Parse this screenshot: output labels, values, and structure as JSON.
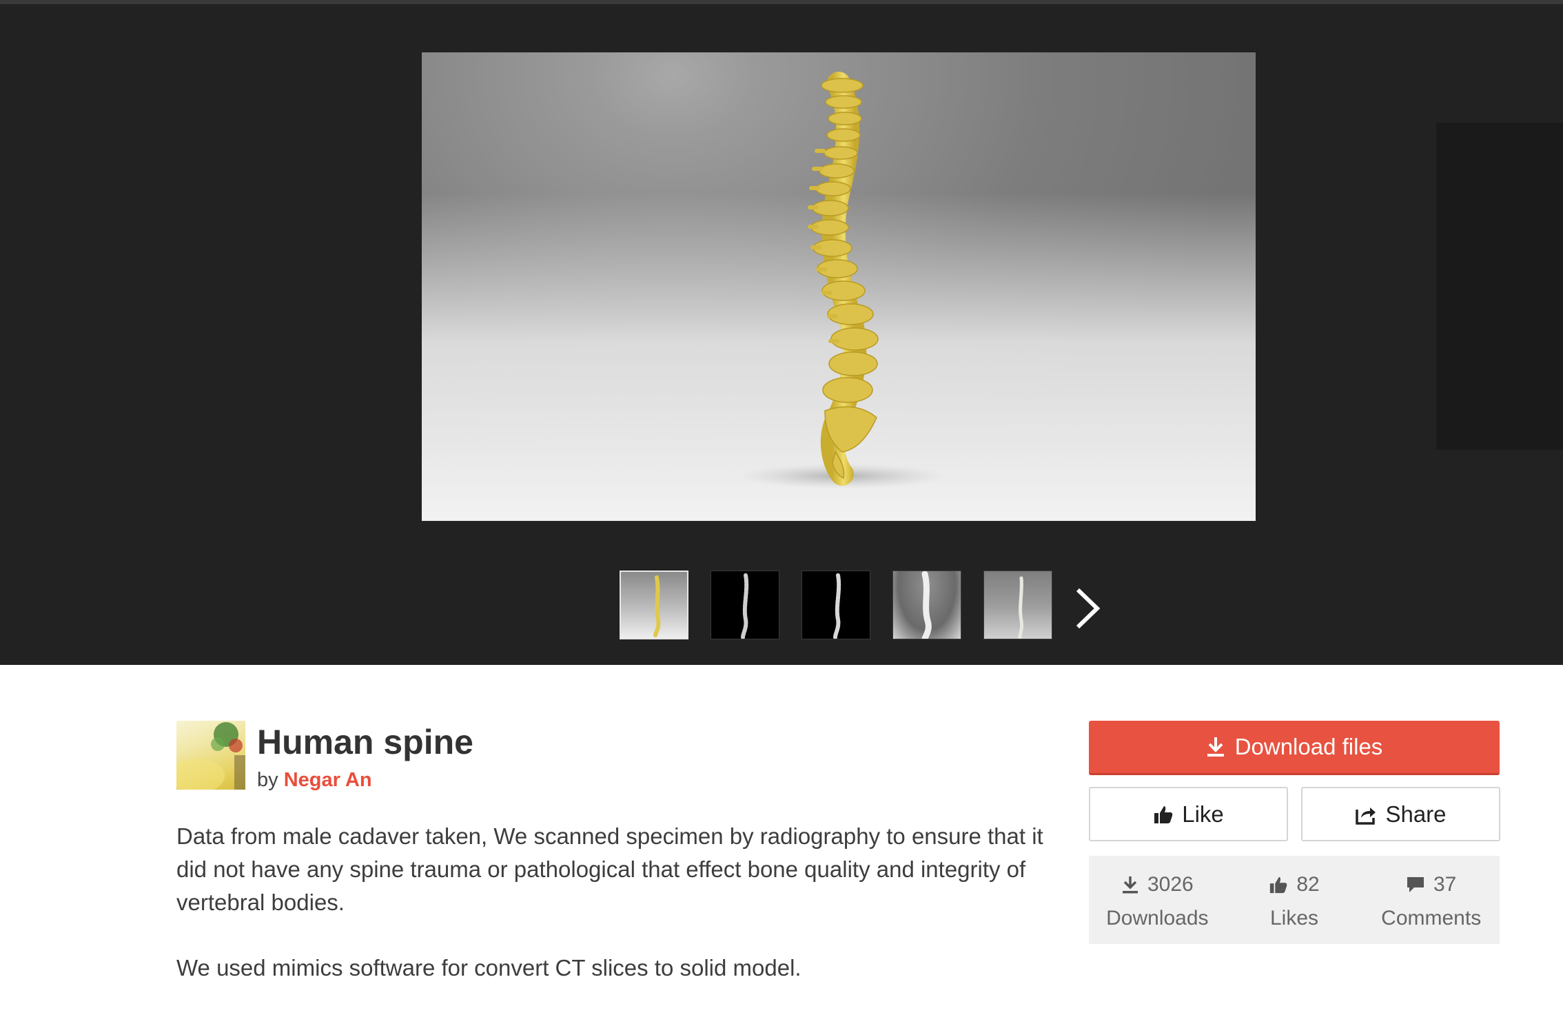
{
  "gallery": {
    "thumbnails": [
      {
        "name": "thumbnail-1",
        "active": true
      },
      {
        "name": "thumbnail-2",
        "active": false
      },
      {
        "name": "thumbnail-3",
        "active": false
      },
      {
        "name": "thumbnail-4",
        "active": false
      },
      {
        "name": "thumbnail-5",
        "active": false
      }
    ],
    "next_icon": "chevron-right-icon"
  },
  "model": {
    "title": "Human spine",
    "by_prefix": "by",
    "author": "Negar An",
    "description": [
      "Data from male cadaver taken, We scanned specimen by radiography to ensure that it did not have any spine trauma or pathological that effect bone quality and integrity of vertebral bodies.",
      "We used mimics software for convert CT slices to solid model."
    ]
  },
  "actions": {
    "download_label": "Download files",
    "like_label": "Like",
    "share_label": "Share",
    "download_icon": "download-icon",
    "like_icon": "thumbs-up-icon",
    "share_icon": "share-icon"
  },
  "stats": {
    "downloads": {
      "value": "3026",
      "label": "Downloads"
    },
    "likes": {
      "value": "82",
      "label": "Likes"
    },
    "comments": {
      "value": "37",
      "label": "Comments"
    }
  },
  "colors": {
    "accent": "#e84e3c",
    "gallery_bg": "#222222",
    "spine": "#e6cf52"
  }
}
